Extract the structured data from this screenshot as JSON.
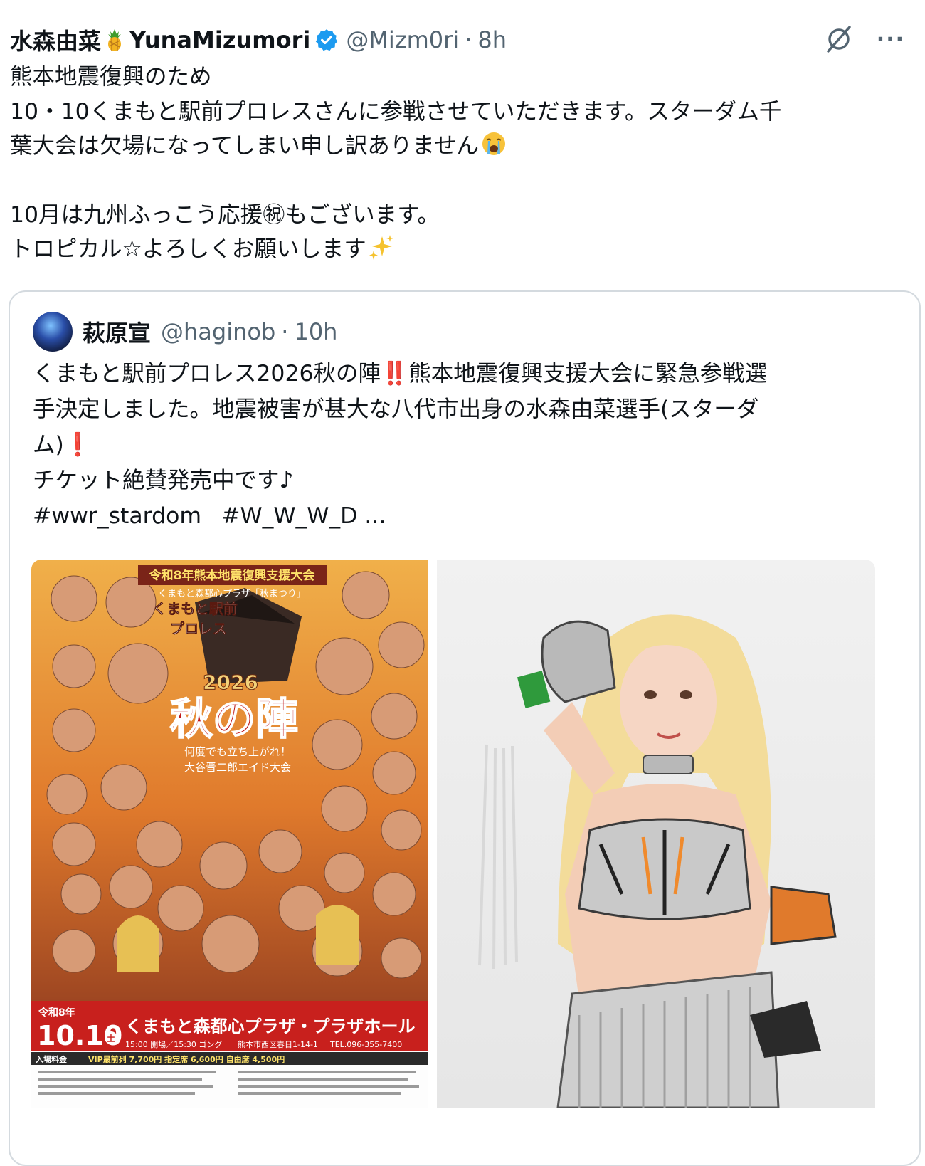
{
  "tweet": {
    "display_name": "水森由菜",
    "display_name_latin": "YunaMizumori",
    "handle": "@Mizm0ri",
    "separator": "·",
    "time": "8h",
    "more": "···",
    "icons": {
      "name_emoji": "pineapple-emoji",
      "badge": "verified-badge",
      "grok": "grok-icon",
      "more": "more-icon"
    },
    "lines": [
      "熊本地震復興のため",
      "10・10くまもと駅前プロレスさんに参戦させていただきます。スターダム千",
      "葉大会は欠場になってしまい申し訳ありません",
      "",
      "10月は九州ふっこう応援㊗もございます。",
      "トロピカル☆よろしくお願いします"
    ],
    "line_emojis": {
      "line3": "crying-face",
      "line6": "sparkles"
    }
  },
  "quote": {
    "display_name": "萩原宣",
    "handle": "@haginob",
    "separator": "·",
    "time": "10h",
    "lines": [
      "くまもと駅前プロレス2026秋の陣‼️熊本地震復興支援大会に緊急参戦選",
      "手決定しました。地震被害が甚大な八代市出身の水森由菜選手(スターダ",
      "ム)❗",
      "チケット絶賛発売中です♪"
    ],
    "hashtags": [
      "#wwr_stardom",
      "#W_W_W_D ..."
    ],
    "poster": {
      "banner": "令和8年熊本地震復興支援大会",
      "sub_banner": "くまもと森都心プラザ「秋まつり」",
      "promotion": "くまもと駅前",
      "promotion2": "プロレス",
      "year": "2026",
      "title": "秋の陣",
      "tagline": "何度でも立ち上がれ！",
      "tagline2": "大谷晋二郎エイド大会",
      "era": "令和8年",
      "date": "10.10",
      "weekday": "土",
      "venue": "くまもと森都心プラザ・プラザホール",
      "times": "15:00 開場／15:30 ゴング",
      "address": "熊本市西区春日1-14-1",
      "tel": "TEL.096-355-7400",
      "admission_label": "入場料金",
      "prices": "VIP最前列 7,700円  指定席 6,600円  自由席 4,500円"
    },
    "photo_alt_icon": "wrestler-photo"
  },
  "colors": {
    "text": "#0f1419",
    "secondary": "#536471",
    "verified": "#1d9bf0",
    "border": "#d4dadf",
    "poster_red": "#c8201d"
  }
}
